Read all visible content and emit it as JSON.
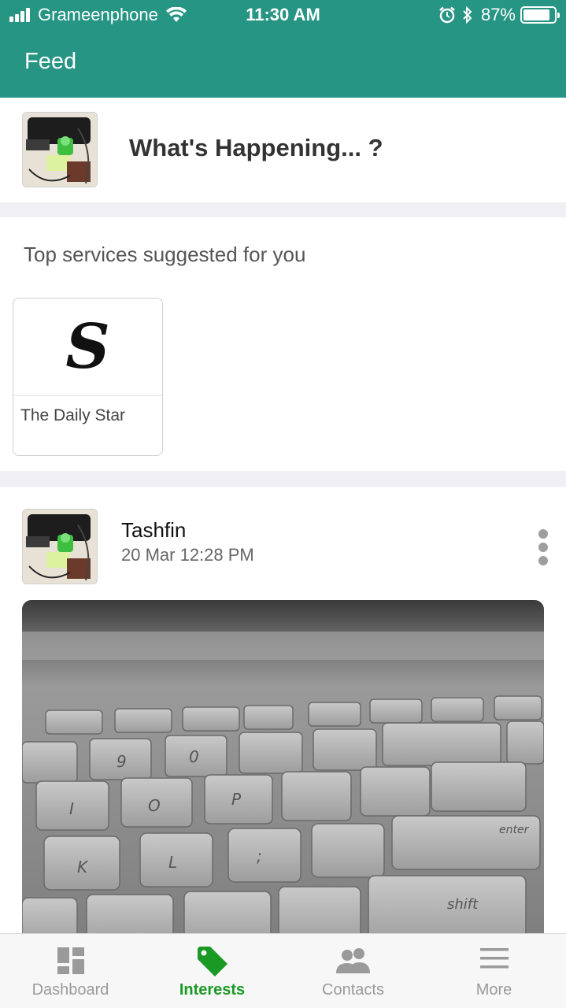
{
  "status_bar": {
    "carrier": "Grameenphone",
    "time": "11:30 AM",
    "battery": "87%",
    "battery_level": 0.87
  },
  "nav": {
    "title": "Feed"
  },
  "composer": {
    "prompt": "What's Happening... ?"
  },
  "suggestions": {
    "title": "Top services suggested for you",
    "services": [
      {
        "logo_glyph": "S",
        "name": "The Daily Star"
      }
    ]
  },
  "post": {
    "author": "Tashfin",
    "time": "20 Mar 12:28 PM"
  },
  "tab_bar": {
    "active": "Interests",
    "active_color": "#1a9a25",
    "tabs": [
      {
        "label": "Dashboard",
        "icon": "dashboard-icon"
      },
      {
        "label": "Interests",
        "icon": "tag-icon"
      },
      {
        "label": "Contacts",
        "icon": "contacts-icon"
      },
      {
        "label": "More",
        "icon": "menu-icon"
      }
    ]
  },
  "colors": {
    "brand": "#279584",
    "background": "#efeff4"
  }
}
